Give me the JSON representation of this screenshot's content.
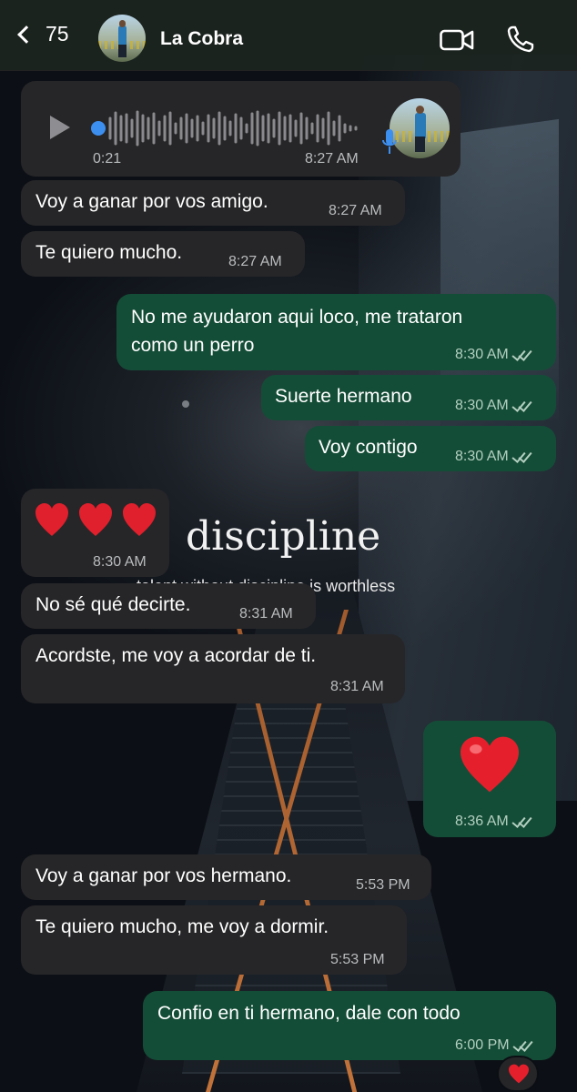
{
  "header": {
    "back_count": "75",
    "contact_name": "La Cobra"
  },
  "wallpaper": {
    "title": "discipline",
    "subtitle": "talent without discipline is worthless"
  },
  "voice_message": {
    "duration": "0:21",
    "time": "8:27 AM"
  },
  "messages": [
    {
      "dir": "in",
      "text": "Voy a ganar por vos amigo.",
      "time": "8:27 AM"
    },
    {
      "dir": "in",
      "text": "Te quiero mucho.",
      "time": "8:27 AM"
    },
    {
      "dir": "out",
      "text_line1": "No me ayudaron aqui loco, me trataron",
      "text_line2": "como un perro",
      "time": "8:30 AM"
    },
    {
      "dir": "out",
      "text": "Suerte hermano",
      "time": "8:30 AM"
    },
    {
      "dir": "out",
      "text": "Voy contigo",
      "time": "8:30 AM"
    },
    {
      "dir": "in",
      "emoji": "❤️❤️❤️",
      "time": "8:30 AM"
    },
    {
      "dir": "in",
      "text": "No sé qué decirte.",
      "time": "8:31 AM"
    },
    {
      "dir": "in",
      "text": "Acordste, me voy a acordar de ti.",
      "time": "8:31 AM"
    },
    {
      "dir": "out",
      "emoji": "❤️",
      "time": "8:36 AM"
    },
    {
      "dir": "in",
      "text": "Voy a ganar por vos hermano.",
      "time": "5:53 PM"
    },
    {
      "dir": "in",
      "text": "Te quiero mucho, me voy a dormir.",
      "time": "5:53 PM"
    },
    {
      "dir": "out",
      "text": "Confio en ti hermano, dale con todo",
      "time": "6:00 PM"
    }
  ],
  "reaction": "❤️",
  "colors": {
    "incoming_bubble": "#262628",
    "outgoing_bubble": "#144d37",
    "header_bg": "#1c2420",
    "audio_dot": "#3d8fef"
  }
}
